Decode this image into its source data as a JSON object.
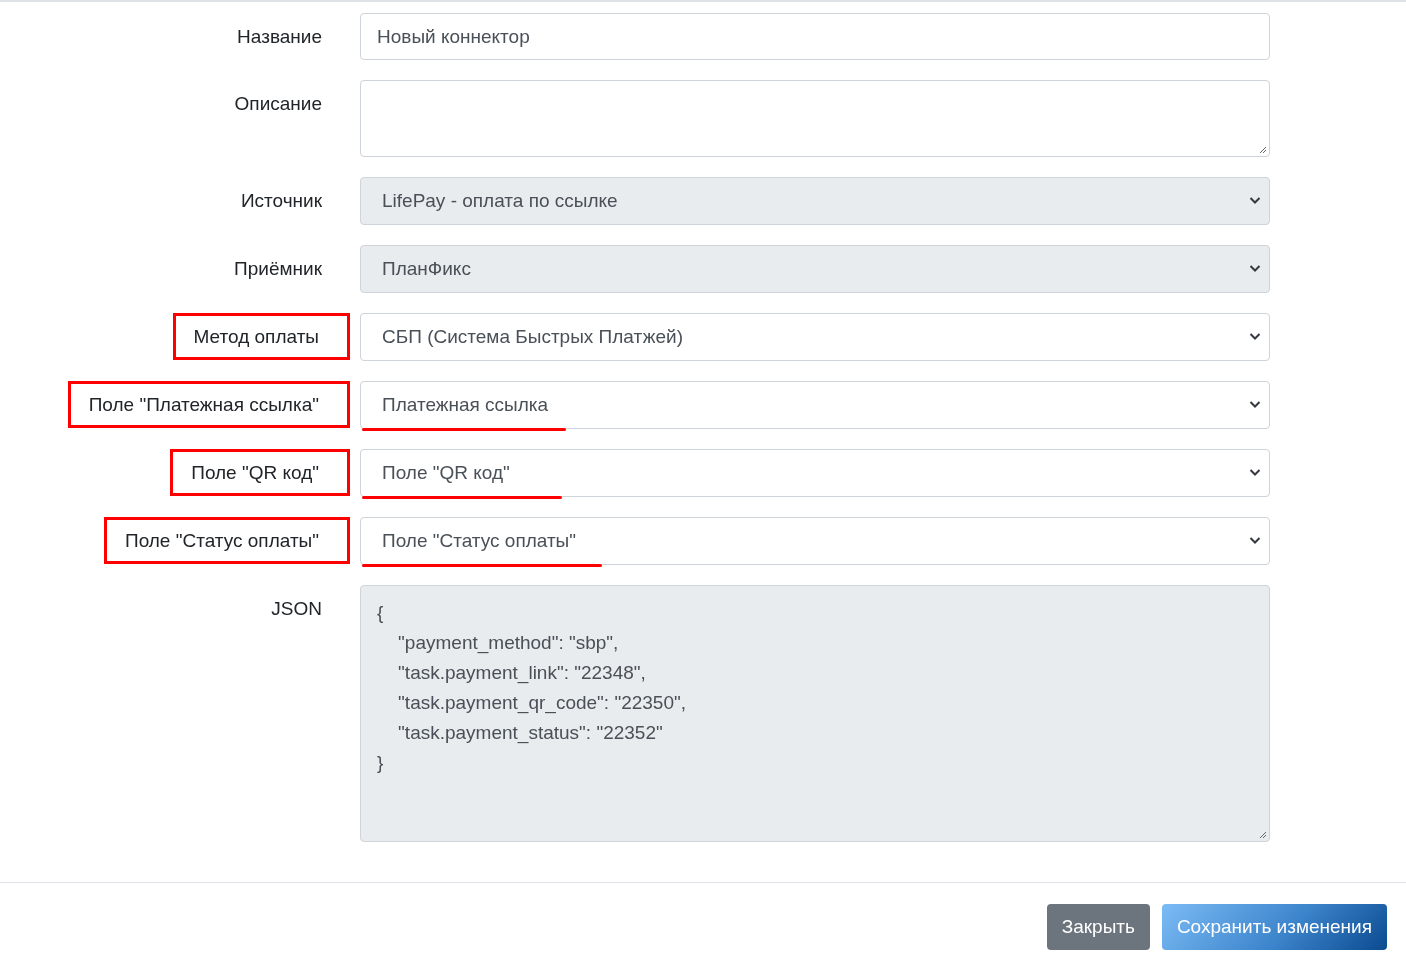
{
  "form": {
    "fields": [
      {
        "label": "Название",
        "kind": "text",
        "value": "Новый коннектор",
        "disabled": false,
        "boxed": false
      },
      {
        "label": "Описание",
        "kind": "textarea",
        "disabled": false,
        "boxed": false
      },
      {
        "label": "Источник",
        "kind": "select",
        "value": "LifePay - оплата по ссылке",
        "disabled": true,
        "boxed": false,
        "underlined": false
      },
      {
        "label": "Приёмник",
        "kind": "select",
        "value": "ПланФикс",
        "disabled": true,
        "boxed": false,
        "underlined": false
      },
      {
        "label": "Метод оплаты",
        "kind": "select",
        "value": "СБП (Система Быстрых Платжей)",
        "disabled": false,
        "boxed": true,
        "underlined": false
      },
      {
        "label": "Поле \"Платежная ссылка\"",
        "kind": "select",
        "value": "Платежная ссылка",
        "disabled": false,
        "boxed": true,
        "underlined": true
      },
      {
        "label": "Поле \"QR код\"",
        "kind": "select",
        "value": "Поле \"QR код\"",
        "disabled": false,
        "boxed": true,
        "underlined": true
      },
      {
        "label": "Поле \"Статус оплаты\"",
        "kind": "select",
        "value": "Поле \"Статус оплаты\"",
        "disabled": false,
        "boxed": true,
        "underlined": true
      },
      {
        "label": "JSON",
        "kind": "code",
        "value": "{\n    \"payment_method\": \"sbp\",\n    \"task.payment_link\": \"22348\",\n    \"task.payment_qr_code\": \"22350\",\n    \"task.payment_status\": \"22352\"\n}",
        "disabled": true,
        "boxed": false
      }
    ]
  },
  "footer": {
    "buttons": [
      {
        "label": "Закрыть",
        "kind": "secondary"
      },
      {
        "label": "Сохранить изменения",
        "kind": "primary"
      }
    ]
  }
}
